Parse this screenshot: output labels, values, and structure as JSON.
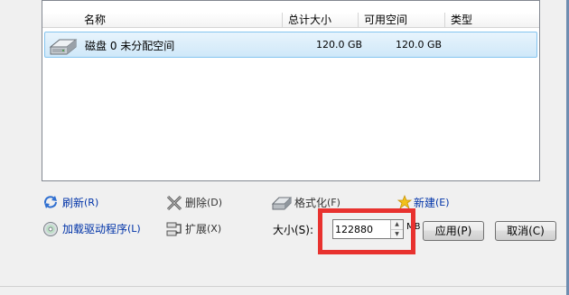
{
  "list": {
    "columns": [
      "名称",
      "总计大小",
      "可用空间",
      "类型"
    ],
    "rows": [
      {
        "name": "磁盘 0 未分配空间",
        "total": "120.0 GB",
        "free": "120.0 GB",
        "type": ""
      }
    ]
  },
  "actions": {
    "refresh": {
      "label": "刷新",
      "key": "(R)"
    },
    "delete": {
      "label": "删除",
      "key": "(D)"
    },
    "format": {
      "label": "格式化",
      "key": "(F)"
    },
    "new": {
      "label": "新建",
      "key": "(E)"
    },
    "load_driver": {
      "label": "加载驱动程序",
      "key": "(L)"
    },
    "extend": {
      "label": "扩展",
      "key": "(X)"
    }
  },
  "size": {
    "label": "大小(S):",
    "value": "122880",
    "unit": "MB"
  },
  "buttons": {
    "apply": "应用(P)",
    "cancel": "取消(C)"
  },
  "colors": {
    "link": "#0033a8",
    "highlight": "#e8322f",
    "selection": "#cfe8f9"
  }
}
